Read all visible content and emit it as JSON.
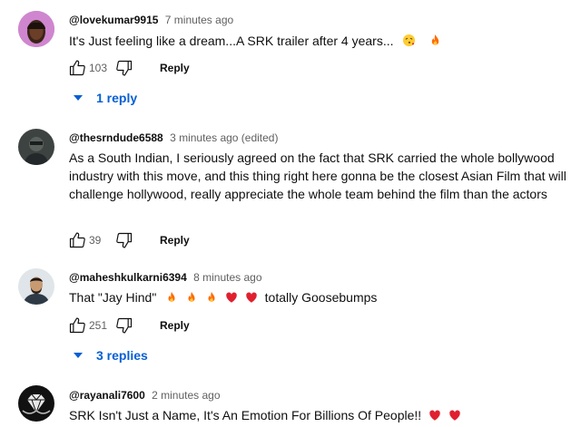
{
  "colors": {
    "link": "#065fd4",
    "muted": "#606060",
    "fire": "#ff6a00",
    "heart": "#e0202f"
  },
  "comments": [
    {
      "handle": "@lovekumar9915",
      "time": "7 minutes ago",
      "text": "It's Just feeling like a dream...A SRK trailer after 4 years...",
      "emojis": [
        "kissing-face-emoji",
        "fire-emoji"
      ],
      "likes": "103",
      "reply_label": "Reply",
      "replies_label": "1 reply"
    },
    {
      "handle": "@thesrndude6588",
      "time": "3 minutes ago (edited)",
      "text": "As a South Indian, I seriously agreed on the fact that SRK carried the whole bollywood industry with this move, and this thing right here gonna be the closest Asian Film that will challenge hollywood, really appreciate the whole team behind the film than the actors",
      "likes": "39",
      "reply_label": "Reply"
    },
    {
      "handle": "@maheshkulkarni6394",
      "time": "8 minutes ago",
      "text": "That \"Jay Hind\"",
      "text_after": "totally Goosebumps",
      "emojis": [
        "fire-emoji",
        "fire-emoji",
        "fire-emoji",
        "heart-emoji",
        "heart-emoji"
      ],
      "likes": "251",
      "reply_label": "Reply",
      "replies_label": "3 replies"
    },
    {
      "handle": "@rayanali7600",
      "time": "2 minutes ago",
      "text": "SRK Isn't Just a Name, It's An Emotion For Billions Of People!!",
      "emojis": [
        "heart-emoji",
        "heart-emoji"
      ]
    }
  ]
}
